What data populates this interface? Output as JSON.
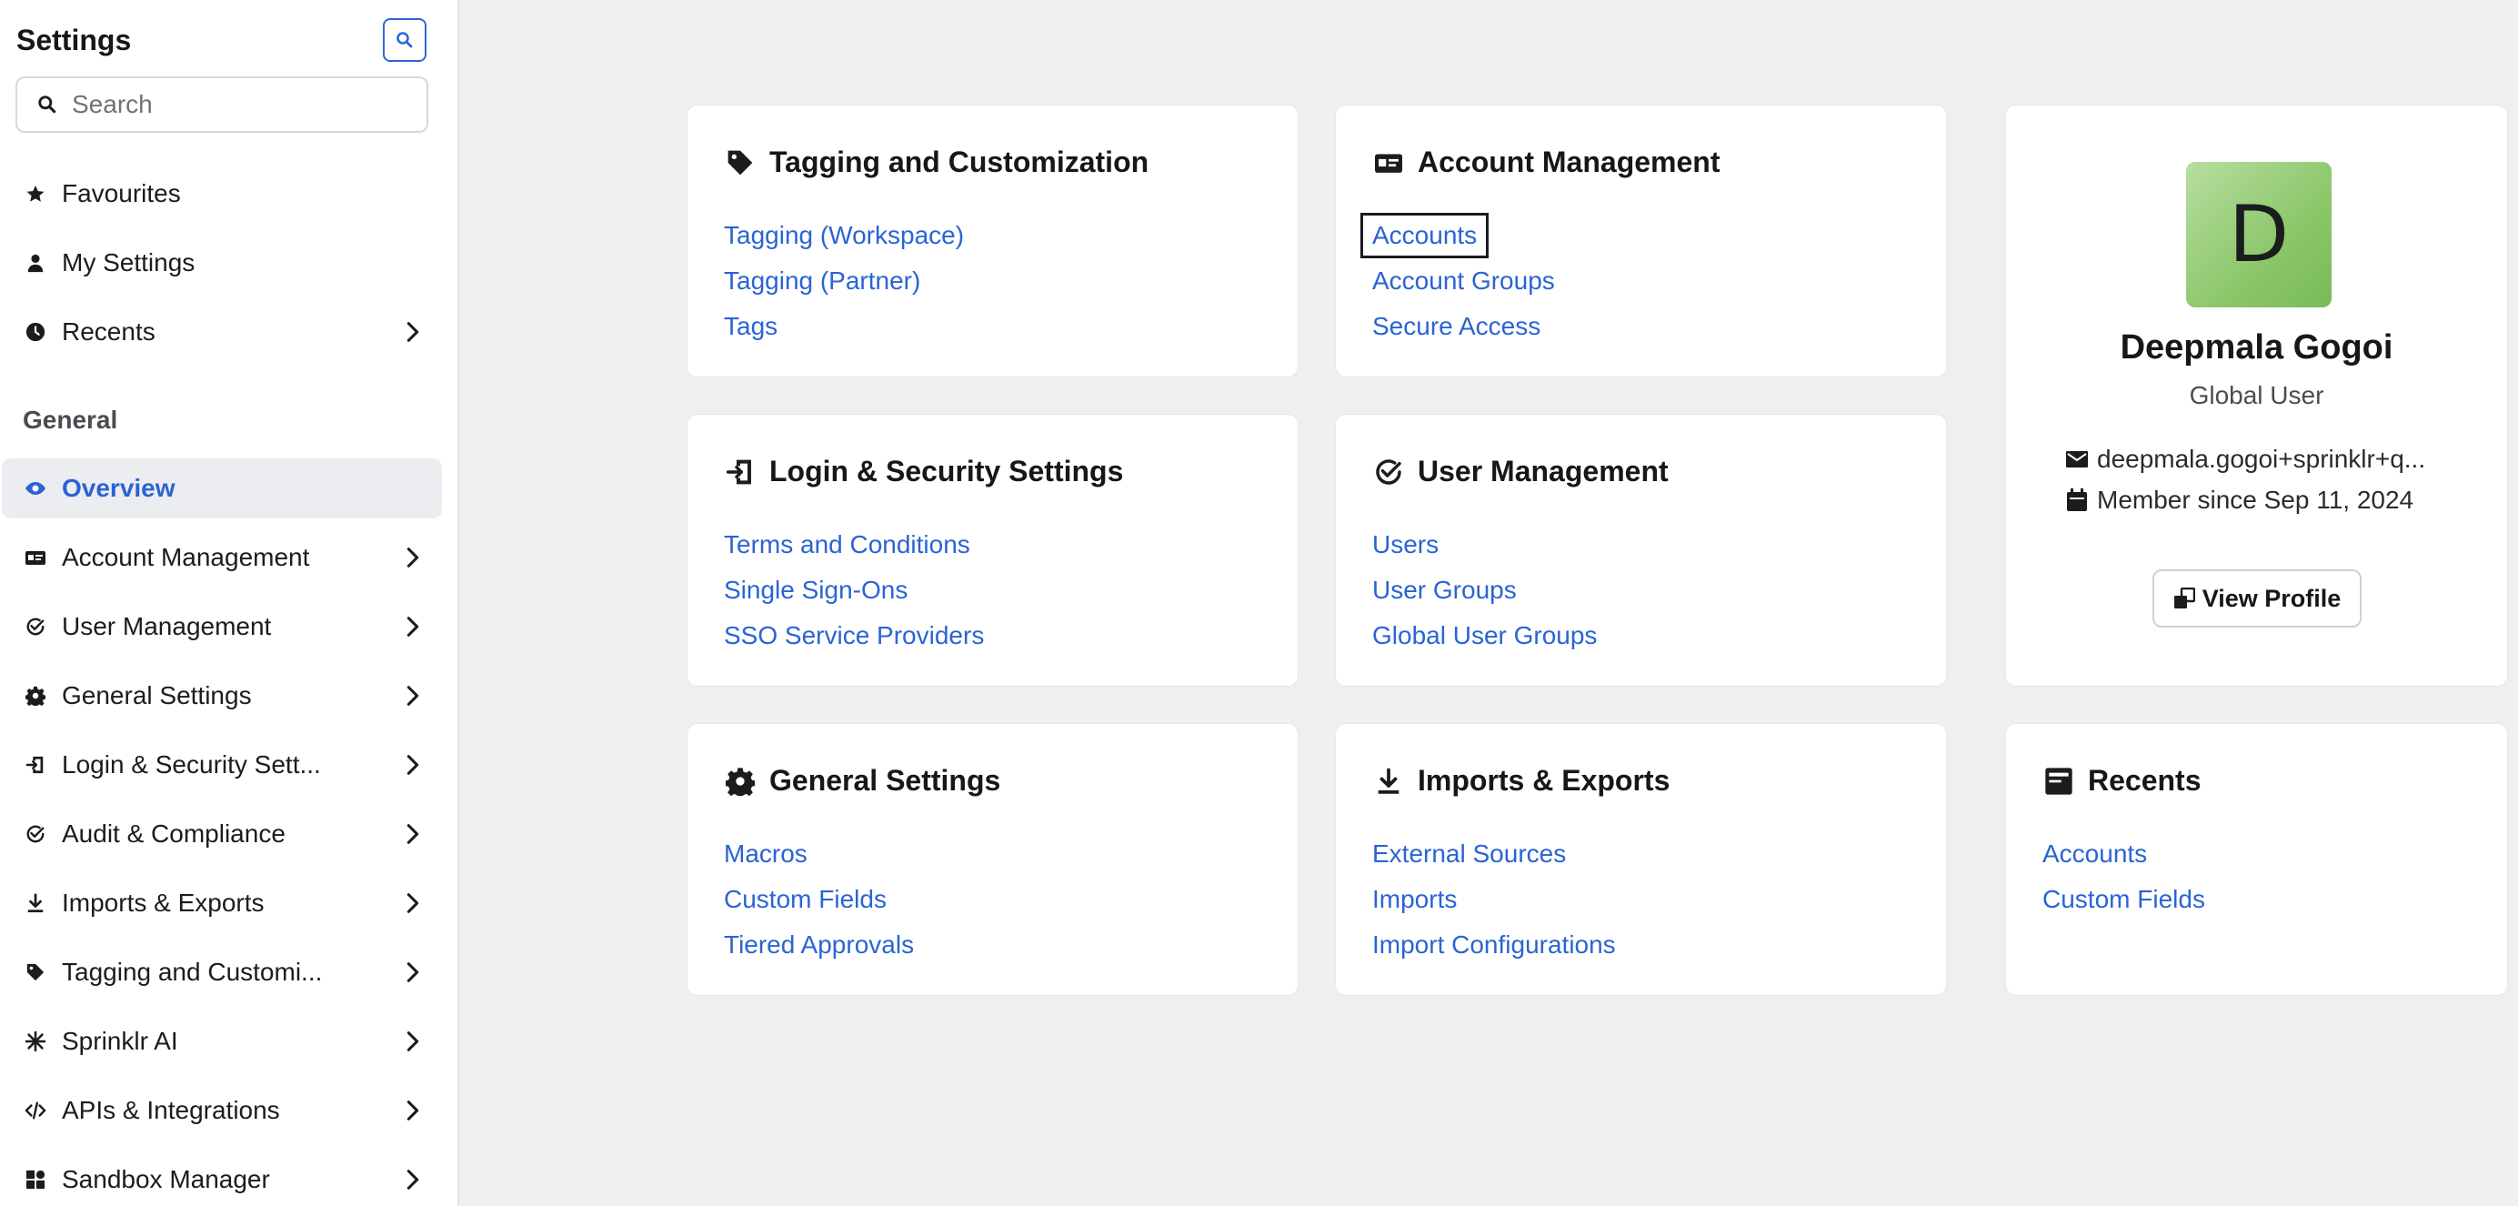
{
  "sidebar": {
    "title": "Settings",
    "search_placeholder": "Search",
    "top_items": [
      {
        "label": "Favourites",
        "icon": "star-icon"
      },
      {
        "label": "My Settings",
        "icon": "user-icon"
      },
      {
        "label": "Recents",
        "icon": "clock-icon"
      }
    ],
    "section_label": "General",
    "items": [
      {
        "label": "Overview",
        "icon": "eye-icon",
        "active": true
      },
      {
        "label": "Account Management",
        "icon": "id-card-icon"
      },
      {
        "label": "User Management",
        "icon": "check-circle-icon"
      },
      {
        "label": "General Settings",
        "icon": "gear-icon"
      },
      {
        "label": "Login & Security Sett...",
        "icon": "login-icon"
      },
      {
        "label": "Audit & Compliance",
        "icon": "check-circle-icon"
      },
      {
        "label": "Imports & Exports",
        "icon": "download-icon"
      },
      {
        "label": "Tagging and Customi...",
        "icon": "tag-icon"
      },
      {
        "label": "Sprinklr AI",
        "icon": "sparkle-icon"
      },
      {
        "label": "APIs & Integrations",
        "icon": "code-icon"
      },
      {
        "label": "Sandbox Manager",
        "icon": "grid-icon"
      }
    ]
  },
  "cards": {
    "tagging": {
      "title": "Tagging and Customization",
      "icon": "tag-icon",
      "links": [
        "Tagging (Workspace)",
        "Tagging (Partner)",
        "Tags"
      ]
    },
    "account": {
      "title": "Account Management",
      "icon": "id-card-icon",
      "links": [
        "Accounts",
        "Account Groups",
        "Secure Access"
      ]
    },
    "login": {
      "title": "Login & Security Settings",
      "icon": "login-icon",
      "links": [
        "Terms and Conditions",
        "Single Sign-Ons",
        "SSO Service Providers"
      ]
    },
    "user": {
      "title": "User Management",
      "icon": "check-circle-icon",
      "links": [
        "Users",
        "User Groups",
        "Global User Groups"
      ]
    },
    "general": {
      "title": "General Settings",
      "icon": "gear-icon",
      "links": [
        "Macros",
        "Custom Fields",
        "Tiered Approvals"
      ]
    },
    "imports": {
      "title": "Imports & Exports",
      "icon": "download-icon",
      "links": [
        "External Sources",
        "Imports",
        "Import Configurations"
      ]
    },
    "recents": {
      "title": "Recents",
      "icon": "recents-card-icon",
      "links": [
        "Accounts",
        "Custom Fields"
      ]
    }
  },
  "profile": {
    "initial": "D",
    "name": "Deepmala Gogoi",
    "role": "Global User",
    "email": "deepmala.gogoi+sprinklr+q...",
    "member_since": "Member since Sep 11, 2024",
    "view_label": "View Profile",
    "avatar_color": "#8cc76a"
  },
  "colors": {
    "accent": "#2a64d4",
    "background": "#eeeff1",
    "active_nav_bg": "#ecedf0"
  }
}
